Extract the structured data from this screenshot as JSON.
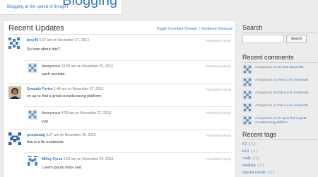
{
  "header": {
    "title": "Blogging",
    "tagline": "Blogging at the speed of thought"
  },
  "main": {
    "section_title": "Recent Updates",
    "links": {
      "toggle": "Toggle Comment Threads",
      "sep": "|",
      "shortcuts": "Keyboard Shortcuts"
    },
    "actions": {
      "permalink": "Permalink",
      "sep": "|",
      "reply": "Reply"
    },
    "posts": [
      {
        "author": "jtrey45",
        "time": "5:07 am",
        "on": "on",
        "date": "November 27, 2013",
        "text": "So how about this?",
        "comment": {
          "author": "Anonymous",
          "time": "10:00 am",
          "on": "on",
          "date": "November 25, 2013",
          "text": "each tocolate"
        }
      },
      {
        "author": "Gonçalo Fortes",
        "time": "1:44 am",
        "on": "on",
        "date": "November 27, 2013",
        "text": "im up to find a great crowdsoucing platform",
        "comment": {
          "author": "Anonymous",
          "time": "4:53 am",
          "on": "on",
          "date": "November 27, 2013",
          "text": "yup"
        }
      },
      {
        "author": "groupeadg",
        "time": "6:27 am",
        "on": "on",
        "date": "November 25, 2013",
        "text": "this is a fin enotenote",
        "comment": {
          "author": "Milley Cyrus",
          "time": "6:52 am",
          "on": "on",
          "date": "November 25, 2013",
          "text": "Lorem ipsum dolor sed"
        }
      }
    ]
  },
  "sidebar": {
    "search": {
      "title": "Search",
      "placeholder": "",
      "button": "Search"
    },
    "recent_comments": {
      "title": "Recent comments",
      "items": [
        {
          "author": "Anonymous",
          "on": "on",
          "post": "So how about this"
        },
        {
          "author": "Anonymous",
          "on": "on",
          "post": "this is a fin enotenote"
        },
        {
          "author": "Anonymous",
          "on": "on",
          "post": "this is a fin enotenote"
        },
        {
          "author": "Anonymous",
          "on": "on",
          "post": "this is a fin enotenote"
        },
        {
          "author": "Anonymous",
          "on": "on",
          "post": "im up to find a great crowdsoucing platform"
        }
      ]
    },
    "recent_tags": {
      "title": "Recent tags",
      "items": [
        {
          "name": "P2",
          "count": "( 1 )"
        },
        {
          "name": "KL3",
          "count": "( 1 )"
        },
        {
          "name": "roafy",
          "count": "( 1 )"
        },
        {
          "name": "meeting",
          "count": "( 1 )"
        },
        {
          "name": "special events",
          "count": "( 1 )"
        }
      ]
    }
  },
  "colors": {
    "link": "#3478c4",
    "accent_identicon": "#3f7fc8",
    "background": "#ececec"
  }
}
